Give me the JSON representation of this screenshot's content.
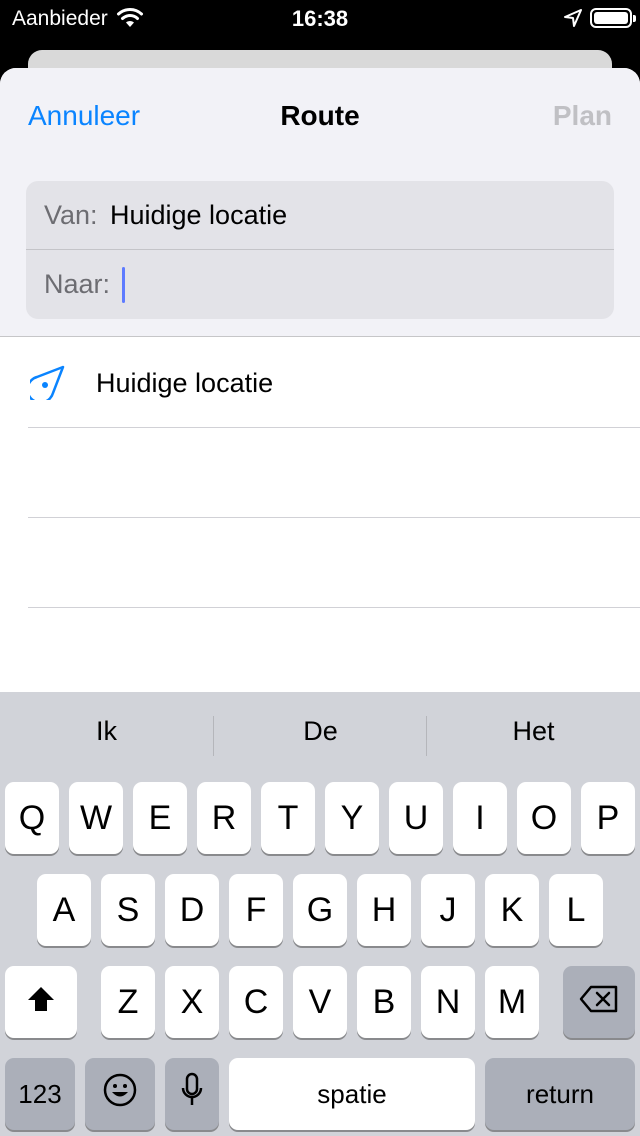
{
  "status_bar": {
    "carrier": "Aanbieder",
    "time": "16:38"
  },
  "nav": {
    "cancel_label": "Annuleer",
    "title": "Route",
    "plan_label": "Plan"
  },
  "route": {
    "from_label": "Van:",
    "from_value": "Huidige locatie",
    "to_label": "Naar:",
    "to_value": ""
  },
  "results": [
    {
      "label": "Huidige locatie",
      "icon": "current-location-icon"
    }
  ],
  "keyboard": {
    "suggestions": [
      "Ik",
      "De",
      "Het"
    ],
    "row1": [
      "Q",
      "W",
      "E",
      "R",
      "T",
      "Y",
      "U",
      "I",
      "O",
      "P"
    ],
    "row2": [
      "A",
      "S",
      "D",
      "F",
      "G",
      "H",
      "J",
      "K",
      "L"
    ],
    "row3": [
      "Z",
      "X",
      "C",
      "V",
      "B",
      "N",
      "M"
    ],
    "numbers_label": "123",
    "space_label": "spatie",
    "return_label": "return"
  },
  "colors": {
    "accent": "#0a84ff",
    "keyboard_bg": "#d1d3d9",
    "caret": "#5e7bff"
  }
}
